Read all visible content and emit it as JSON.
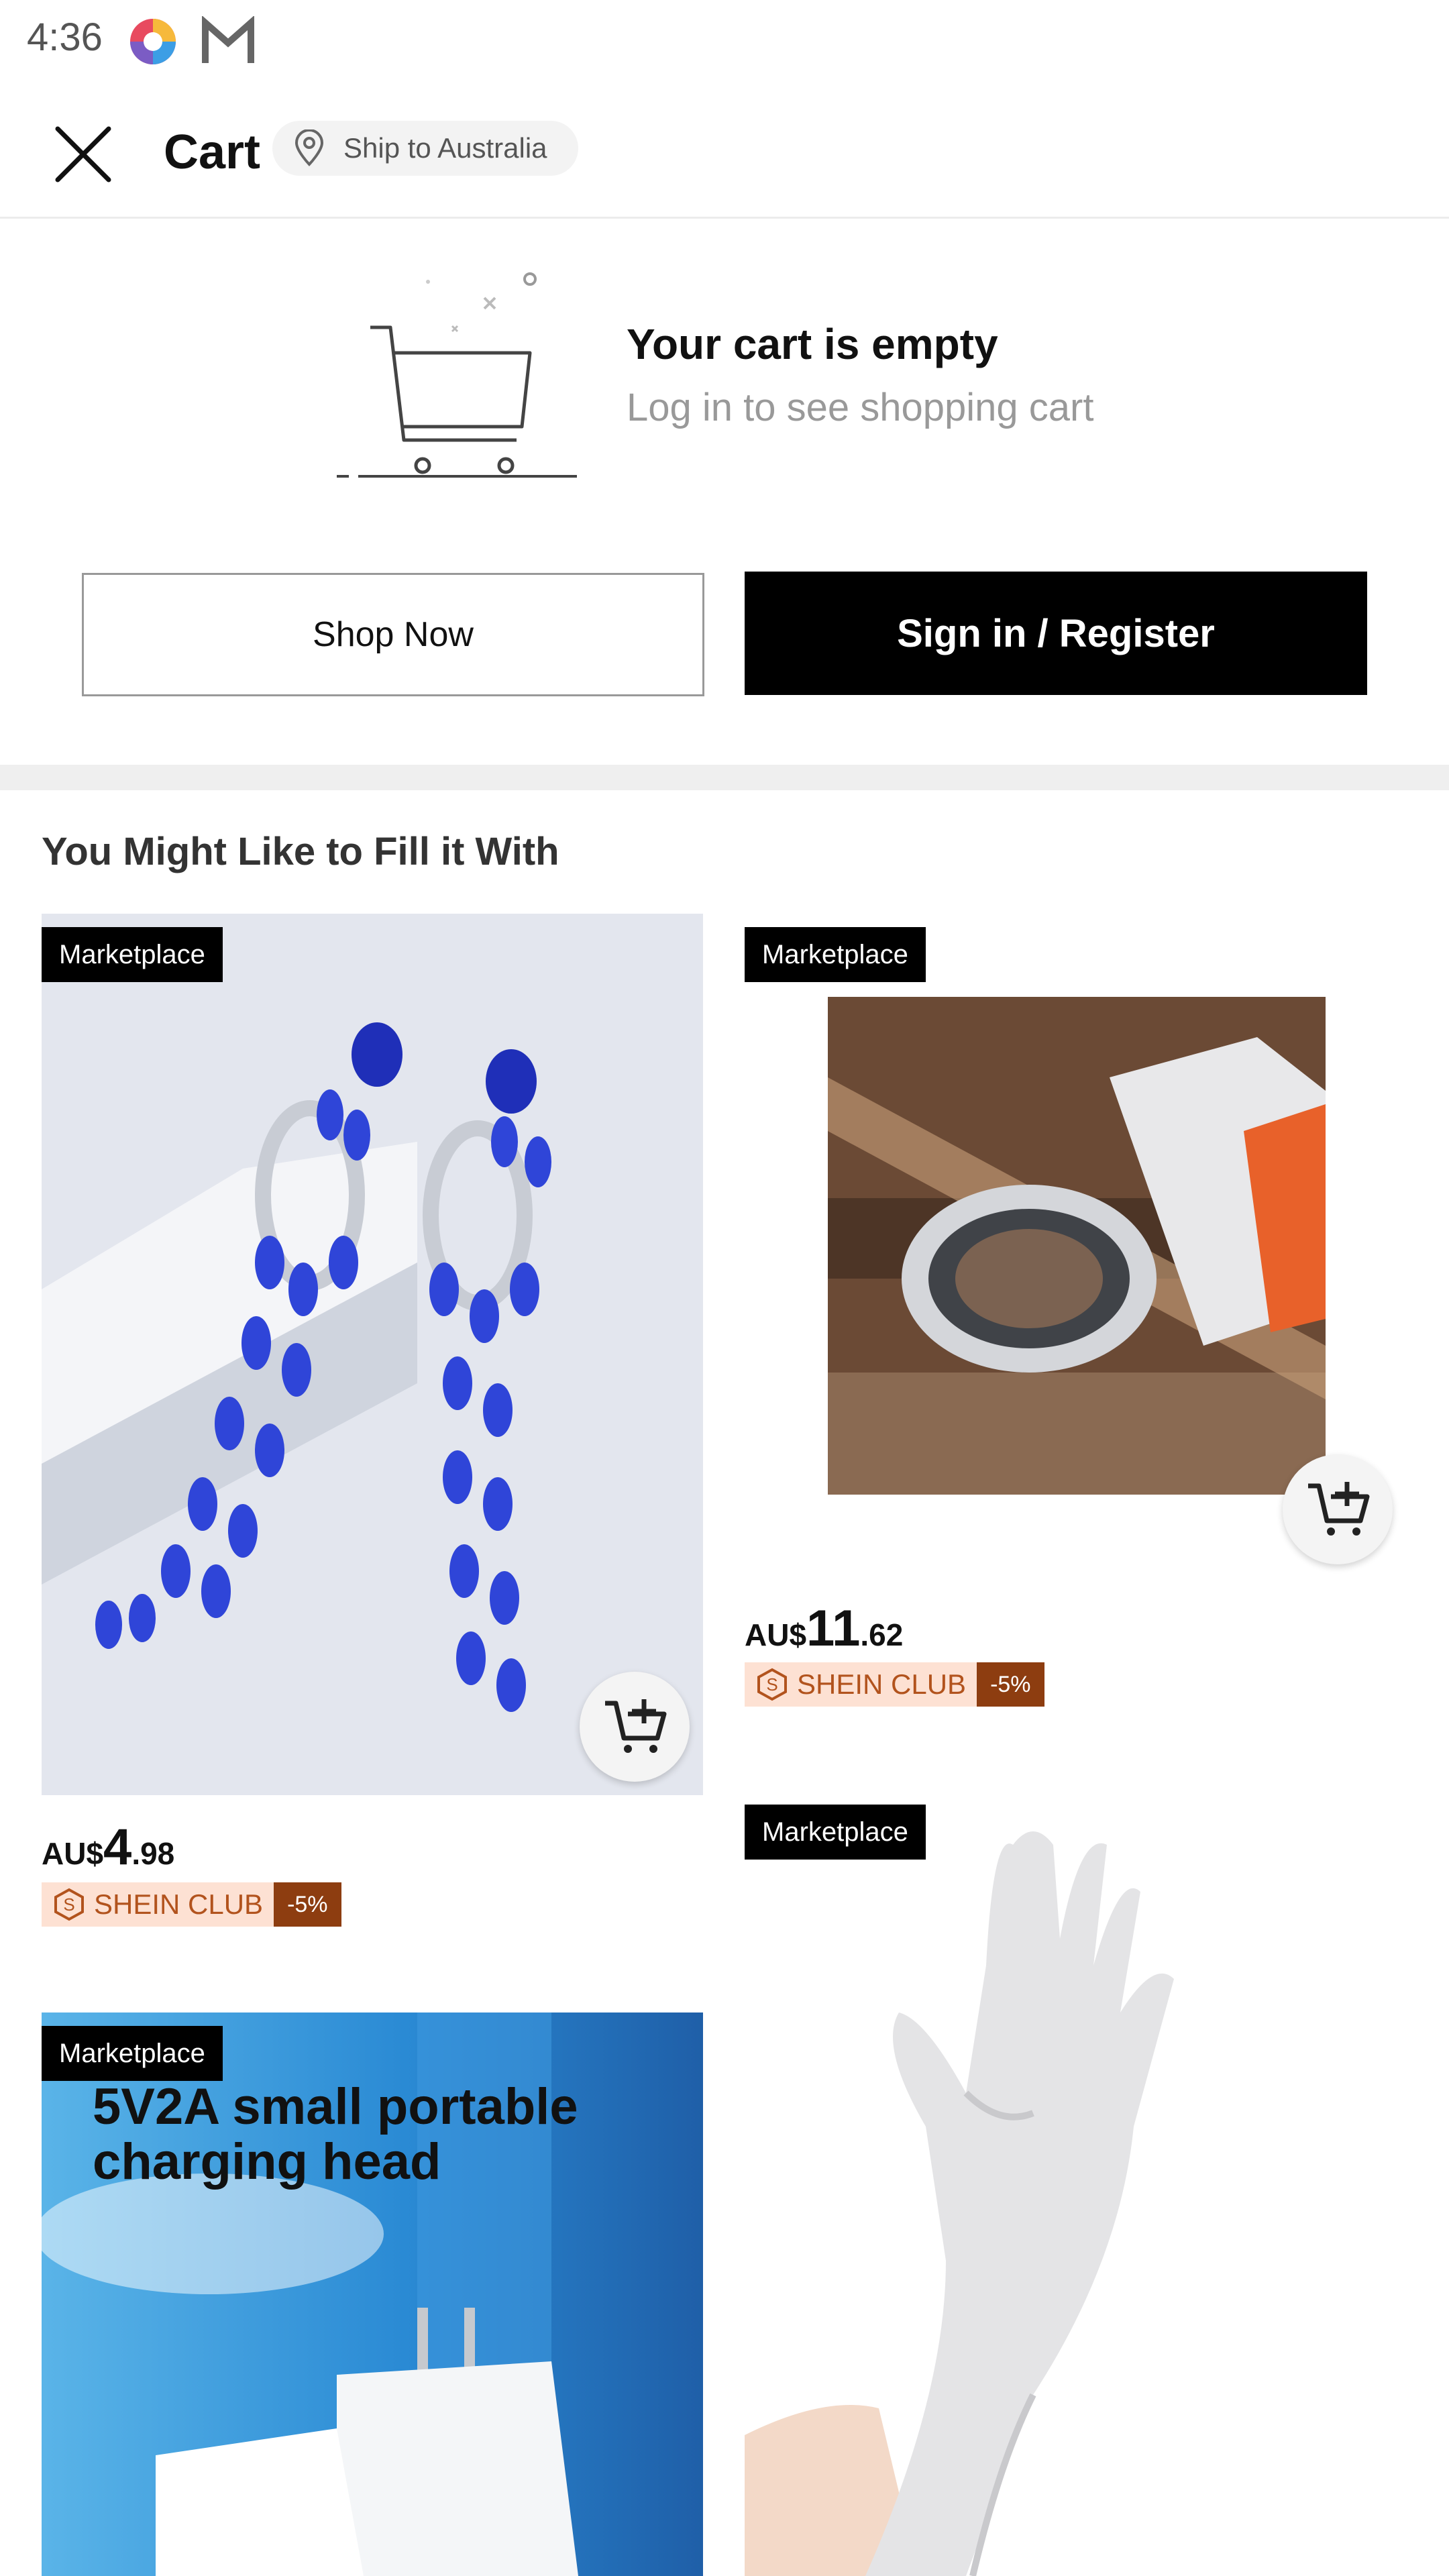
{
  "status_bar": {
    "time": "4:36",
    "icons": [
      "colorful-app-icon",
      "gmail-icon"
    ]
  },
  "header": {
    "title": "Cart",
    "ship_to": "Ship to Australia",
    "close_icon": "close-icon",
    "location_icon": "location-pin-icon"
  },
  "empty_cart": {
    "title": "Your cart is empty",
    "subtitle": "Log in to see shopping cart",
    "illustration_icon": "empty-cart-icon"
  },
  "buttons": {
    "shop_now": "Shop Now",
    "sign_in": "Sign in / Register"
  },
  "recommendations": {
    "title": "You Might Like to Fill it With",
    "products": [
      {
        "badge": "Marketplace",
        "image": "blue-crystal-earrings",
        "price_currency": "AU$",
        "price_whole": "4",
        "price_decimal": ".98",
        "club_label": "SHEIN CLUB",
        "club_discount": "-5%"
      },
      {
        "badge": "Marketplace",
        "image": "angle-grinder-sanding-ring",
        "price_currency": "AU$",
        "price_whole": "11",
        "price_decimal": ".62",
        "club_label": "SHEIN CLUB",
        "club_discount": "-5%"
      },
      {
        "badge": "Marketplace",
        "image": "white-satin-long-gloves"
      },
      {
        "badge": "Marketplace",
        "image": "usb-charger",
        "image_text_line1": "5V2A small portable",
        "image_text_line2": "charging head"
      }
    ]
  },
  "colors": {
    "primary": "#000000",
    "club_bg": "#fde1d3",
    "club_text": "#b2531d",
    "club_discount_bg": "#8d3d10"
  }
}
